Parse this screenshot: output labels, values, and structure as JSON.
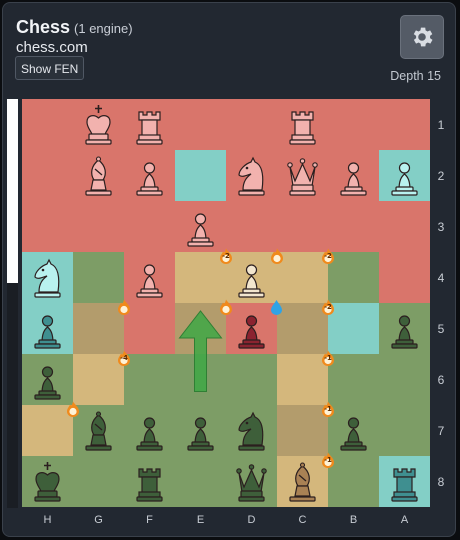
{
  "header": {
    "title": "Chess",
    "engines": "(1 engine)",
    "site": "chess.com",
    "fen_button": "Show FEN",
    "depth": "Depth 15"
  },
  "eval_bar": {
    "white_fraction": 0.45
  },
  "board": {
    "ranks": [
      "1",
      "2",
      "3",
      "4",
      "5",
      "6",
      "7",
      "8"
    ],
    "files": [
      "H",
      "G",
      "F",
      "E",
      "D",
      "C",
      "B",
      "A"
    ],
    "tint_colors": {
      "red": "#d9756b",
      "green": "#7d9d66",
      "cyan": "#83cfc6",
      "tan": "#d4b77c",
      "brown": "#b39c6c"
    },
    "tints": [
      [
        "red",
        "red",
        "red",
        "red",
        "red",
        "red",
        "red",
        "red"
      ],
      [
        "red",
        "red",
        "red",
        "cyan",
        "red",
        "red",
        "red",
        "cyan"
      ],
      [
        "red",
        "red",
        "red",
        "red",
        "red",
        "red",
        "red",
        "red"
      ],
      [
        "cyan",
        "green",
        "red",
        "tan",
        "tan",
        "tan",
        "green",
        "red"
      ],
      [
        "cyan",
        "brown",
        "red",
        "brown",
        "red",
        "brown",
        "cyan",
        "green"
      ],
      [
        "green",
        "tan",
        "green",
        "green",
        "green",
        "tan",
        "green",
        "green"
      ],
      [
        "tan",
        "green",
        "green",
        "green",
        "green",
        "brown",
        "green",
        "green"
      ],
      [
        "green",
        "green",
        "green",
        "green",
        "green",
        "tan",
        "green",
        "cyan"
      ]
    ],
    "pieces": [
      [
        "",
        "K-pink",
        "R-pink",
        "",
        "",
        "R-pink",
        "",
        ""
      ],
      [
        "",
        "B-pink",
        "P-pink",
        "",
        "N-pink",
        "Q-pink",
        "P-pink",
        "P-cyan"
      ],
      [
        "",
        "",
        "",
        "P-pink",
        "",
        "",
        "",
        ""
      ],
      [
        "N-cyan",
        "",
        "P-pink",
        "",
        "P-cream",
        "",
        "",
        ""
      ],
      [
        "P-teal",
        "",
        "",
        "",
        "P-red",
        "",
        "",
        "P-green"
      ],
      [
        "P-green",
        "",
        "",
        "",
        "",
        "",
        "",
        ""
      ],
      [
        "",
        "B-green",
        "P-green",
        "P-green",
        "N-green",
        "",
        "P-green",
        ""
      ],
      [
        "K-green",
        "",
        "R-green",
        "",
        "Q-green",
        "B-tan",
        "",
        "R-teal"
      ]
    ],
    "piece_colors": {
      "pink": "#f2b2ae",
      "cyan": "#b9f2ef",
      "cream": "#f2e6cf",
      "teal": "#3f8f90",
      "red": "#8a2330",
      "green": "#3e5f3a",
      "tan": "#a98154"
    },
    "badges": [
      {
        "r": 3,
        "c": 3,
        "label": "-2",
        "kind": "fire"
      },
      {
        "r": 3,
        "c": 4,
        "label": "",
        "kind": "fire"
      },
      {
        "r": 3,
        "c": 5,
        "label": "-2",
        "kind": "fire"
      },
      {
        "r": 4,
        "c": 1,
        "label": "",
        "kind": "fire"
      },
      {
        "r": 4,
        "c": 3,
        "label": "",
        "kind": "fire"
      },
      {
        "r": 4,
        "c": 5,
        "label": "-2",
        "kind": "fire"
      },
      {
        "r": 4,
        "c": 4,
        "label": "",
        "kind": "drop"
      },
      {
        "r": 5,
        "c": 1,
        "label": "-4",
        "kind": "fire"
      },
      {
        "r": 5,
        "c": 5,
        "label": "-1",
        "kind": "fire"
      },
      {
        "r": 6,
        "c": 0,
        "label": "",
        "kind": "fire"
      },
      {
        "r": 6,
        "c": 5,
        "label": "-1",
        "kind": "fire"
      },
      {
        "r": 7,
        "c": 5,
        "label": "-1",
        "kind": "fire"
      }
    ],
    "arrow": {
      "from": "E6",
      "to": "E5",
      "color": "#3ea845"
    }
  }
}
